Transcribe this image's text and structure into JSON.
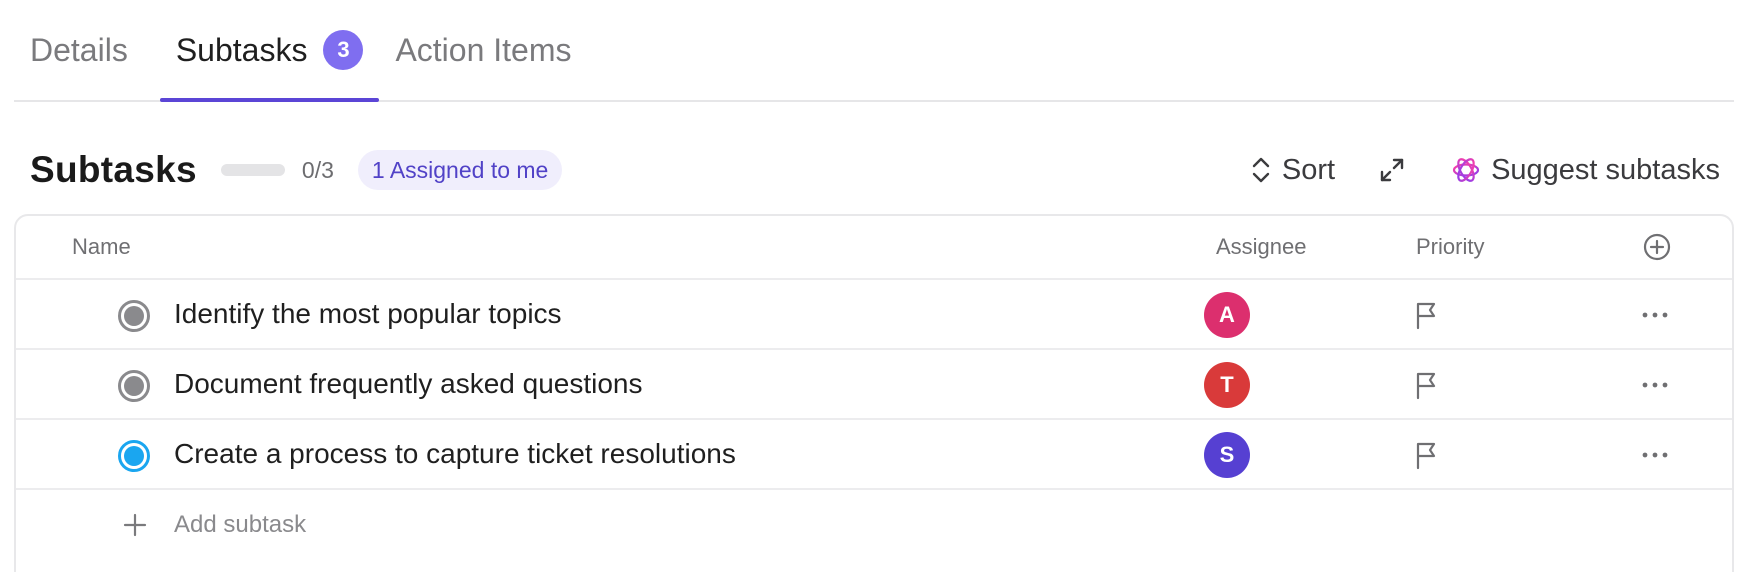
{
  "tabs": [
    {
      "label": "Details"
    },
    {
      "label": "Subtasks",
      "badge": "3"
    },
    {
      "label": "Action Items"
    }
  ],
  "section": {
    "title": "Subtasks",
    "progress_fraction": 0,
    "progress_count": "0/3",
    "assigned_pill": "1 Assigned to me",
    "sort_label": "Sort",
    "suggest_label": "Suggest subtasks"
  },
  "table": {
    "headers": {
      "name": "Name",
      "assignee": "Assignee",
      "priority": "Priority"
    },
    "rows": [
      {
        "name": "Identify the most popular topics",
        "status": "in-progress",
        "assignee_initial": "A",
        "assignee_color": "#dc2f6e"
      },
      {
        "name": "Document frequently asked questions",
        "status": "in-progress",
        "assignee_initial": "T",
        "assignee_color": "#d93a3a"
      },
      {
        "name": "Create a process to capture ticket resolutions",
        "status": "active",
        "assignee_initial": "S",
        "assignee_color": "#5640d2"
      }
    ],
    "add_label": "Add subtask"
  },
  "icons": {
    "sort": "sort-icon",
    "expand": "expand-icon",
    "ai": "ai-sparkle-icon",
    "add_column": "plus-circle-icon",
    "priority": "flag-icon",
    "more": "more-horizontal-icon",
    "add": "plus-icon"
  },
  "colors": {
    "accent": "#5b45d6",
    "badge": "#7f6ef0",
    "status_active": "#1aa6f0",
    "status_progress": "#8a8a8d"
  }
}
